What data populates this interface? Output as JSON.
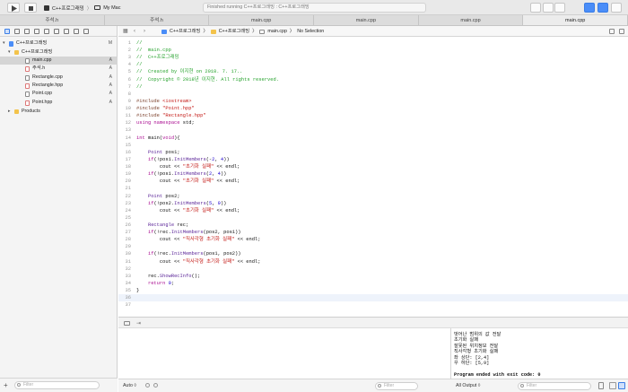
{
  "toolbar": {
    "scheme_name": "C++프로그래밍",
    "destination": "My Mac",
    "status_text": "Finished running C++프로그래밍 : C++프로그래밍"
  },
  "tabs": [
    {
      "label": "주석.h"
    },
    {
      "label": "주석.h"
    },
    {
      "label": "main.cpp"
    },
    {
      "label": "main.cpp"
    },
    {
      "label": "main.cpp"
    },
    {
      "label": "main.cpp",
      "active": true
    }
  ],
  "navigator": {
    "items": [
      {
        "label": "C++프로그래밍",
        "badge": "M",
        "kind": "project"
      },
      {
        "label": "C++프로그래밍",
        "badge": "",
        "kind": "folder"
      },
      {
        "label": "main.cpp",
        "badge": "A",
        "kind": "cpp",
        "selected": true
      },
      {
        "label": "주석.h",
        "badge": "A",
        "kind": "h"
      },
      {
        "label": "Rectangle.cpp",
        "badge": "A",
        "kind": "cpp"
      },
      {
        "label": "Rectangle.hpp",
        "badge": "A",
        "kind": "h"
      },
      {
        "label": "Point.cpp",
        "badge": "A",
        "kind": "cpp"
      },
      {
        "label": "Point.hpp",
        "badge": "A",
        "kind": "h"
      },
      {
        "label": "Products",
        "badge": "",
        "kind": "folder"
      }
    ],
    "filter_placeholder": "Filter"
  },
  "jumpbar": {
    "crumbs": [
      "C++프로그래밍",
      "C++프로그래밍",
      "main.cpp",
      "No Selection"
    ]
  },
  "editor": {
    "current_line": 36,
    "lines": [
      [
        {
          "t": "//",
          "c": "c-comment"
        }
      ],
      [
        {
          "t": "//  main.cpp",
          "c": "c-comment"
        }
      ],
      [
        {
          "t": "//  C++프로그래밍",
          "c": "c-comment"
        }
      ],
      [
        {
          "t": "//",
          "c": "c-comment"
        }
      ],
      [
        {
          "t": "//  Created by 이지현 on 2018. 7. 17..",
          "c": "c-comment"
        }
      ],
      [
        {
          "t": "//  Copyright © 2018년 이지현. All rights reserved.",
          "c": "c-comment"
        }
      ],
      [
        {
          "t": "//",
          "c": "c-comment"
        }
      ],
      [],
      [
        {
          "t": "#include ",
          "c": "c-pre"
        },
        {
          "t": "<iostream>",
          "c": "c-str"
        }
      ],
      [
        {
          "t": "#include ",
          "c": "c-pre"
        },
        {
          "t": "\"Point.hpp\"",
          "c": "c-str"
        }
      ],
      [
        {
          "t": "#include ",
          "c": "c-pre"
        },
        {
          "t": "\"Rectangle.hpp\"",
          "c": "c-str"
        }
      ],
      [
        {
          "t": "using namespace ",
          "c": "c-kw"
        },
        {
          "t": "std;",
          "c": ""
        }
      ],
      [],
      [
        {
          "t": "int ",
          "c": "c-kw"
        },
        {
          "t": "main(",
          "c": ""
        },
        {
          "t": "void",
          "c": "c-kw"
        },
        {
          "t": "){",
          "c": ""
        }
      ],
      [],
      [
        {
          "t": "    ",
          "c": ""
        },
        {
          "t": "Point",
          "c": "c-type"
        },
        {
          "t": " pos1;",
          "c": ""
        }
      ],
      [
        {
          "t": "    ",
          "c": ""
        },
        {
          "t": "if",
          "c": "c-kw"
        },
        {
          "t": "(!pos1.",
          "c": ""
        },
        {
          "t": "InitMembers",
          "c": "c-type"
        },
        {
          "t": "(-",
          "c": ""
        },
        {
          "t": "2",
          "c": "c-num"
        },
        {
          "t": ", ",
          "c": ""
        },
        {
          "t": "4",
          "c": "c-num"
        },
        {
          "t": "))",
          "c": ""
        }
      ],
      [
        {
          "t": "        cout << ",
          "c": ""
        },
        {
          "t": "\"초기화 실패\"",
          "c": "c-str"
        },
        {
          "t": " << endl;",
          "c": ""
        }
      ],
      [
        {
          "t": "    ",
          "c": ""
        },
        {
          "t": "if",
          "c": "c-kw"
        },
        {
          "t": "(!pos1.",
          "c": ""
        },
        {
          "t": "InitMembers",
          "c": "c-type"
        },
        {
          "t": "(",
          "c": ""
        },
        {
          "t": "2",
          "c": "c-num"
        },
        {
          "t": ", ",
          "c": ""
        },
        {
          "t": "4",
          "c": "c-num"
        },
        {
          "t": "))",
          "c": ""
        }
      ],
      [
        {
          "t": "        cout << ",
          "c": ""
        },
        {
          "t": "\"초기화 실패\"",
          "c": "c-str"
        },
        {
          "t": " << endl;",
          "c": ""
        }
      ],
      [],
      [
        {
          "t": "    ",
          "c": ""
        },
        {
          "t": "Point",
          "c": "c-type"
        },
        {
          "t": " pos2;",
          "c": ""
        }
      ],
      [
        {
          "t": "    ",
          "c": ""
        },
        {
          "t": "if",
          "c": "c-kw"
        },
        {
          "t": "(!pos2.",
          "c": ""
        },
        {
          "t": "InitMembers",
          "c": "c-type"
        },
        {
          "t": "(",
          "c": ""
        },
        {
          "t": "5",
          "c": "c-num"
        },
        {
          "t": ", ",
          "c": ""
        },
        {
          "t": "9",
          "c": "c-num"
        },
        {
          "t": "))",
          "c": ""
        }
      ],
      [
        {
          "t": "        cout << ",
          "c": ""
        },
        {
          "t": "\"초기화 실패\"",
          "c": "c-str"
        },
        {
          "t": " << endl;",
          "c": ""
        }
      ],
      [],
      [
        {
          "t": "    ",
          "c": ""
        },
        {
          "t": "Rectangle",
          "c": "c-type"
        },
        {
          "t": " rec;",
          "c": ""
        }
      ],
      [
        {
          "t": "    ",
          "c": ""
        },
        {
          "t": "if",
          "c": "c-kw"
        },
        {
          "t": "(!rec.",
          "c": ""
        },
        {
          "t": "InitMembers",
          "c": "c-type"
        },
        {
          "t": "(pos2, pos1))",
          "c": ""
        }
      ],
      [
        {
          "t": "        cout << ",
          "c": ""
        },
        {
          "t": "\"직사각형 초기화 실패\"",
          "c": "c-str"
        },
        {
          "t": " << endl;",
          "c": ""
        }
      ],
      [],
      [
        {
          "t": "    ",
          "c": ""
        },
        {
          "t": "if",
          "c": "c-kw"
        },
        {
          "t": "(!rec.",
          "c": ""
        },
        {
          "t": "InitMembers",
          "c": "c-type"
        },
        {
          "t": "(pos1, pos2))",
          "c": ""
        }
      ],
      [
        {
          "t": "        cout << ",
          "c": ""
        },
        {
          "t": "\"직사각형 초기화 실패\"",
          "c": "c-str"
        },
        {
          "t": " << endl;",
          "c": ""
        }
      ],
      [],
      [
        {
          "t": "    rec.",
          "c": ""
        },
        {
          "t": "ShowRecInfo",
          "c": "c-type"
        },
        {
          "t": "();",
          "c": ""
        }
      ],
      [
        {
          "t": "    ",
          "c": ""
        },
        {
          "t": "return ",
          "c": "c-kw"
        },
        {
          "t": "0",
          "c": "c-num"
        },
        {
          "t": ";",
          "c": ""
        }
      ],
      [
        {
          "t": "}",
          "c": ""
        }
      ],
      [],
      []
    ]
  },
  "console": {
    "lines": [
      {
        "text": "벗어난 범위의 값 전달",
        "bold": false
      },
      {
        "text": "초기화 실패",
        "bold": false
      },
      {
        "text": "잘못된 위치정보 전달",
        "bold": false
      },
      {
        "text": "직사각형 초기화 실패",
        "bold": false
      },
      {
        "text": "좌 상단: [2,4]",
        "bold": false
      },
      {
        "text": "우 하단: [5,9]",
        "bold": false
      },
      {
        "text": "",
        "bold": false
      },
      {
        "text": "Program ended with exit code: 0",
        "bold": true
      }
    ]
  },
  "bottom": {
    "auto_label": "Auto ◊",
    "vars_filter": "Filter",
    "output_label": "All Output ◊",
    "console_filter": "Filter"
  },
  "colors": {
    "accent": "#4a8df8",
    "comment": "#27a32e",
    "string": "#c41a16",
    "keyword": "#aa0d91"
  }
}
